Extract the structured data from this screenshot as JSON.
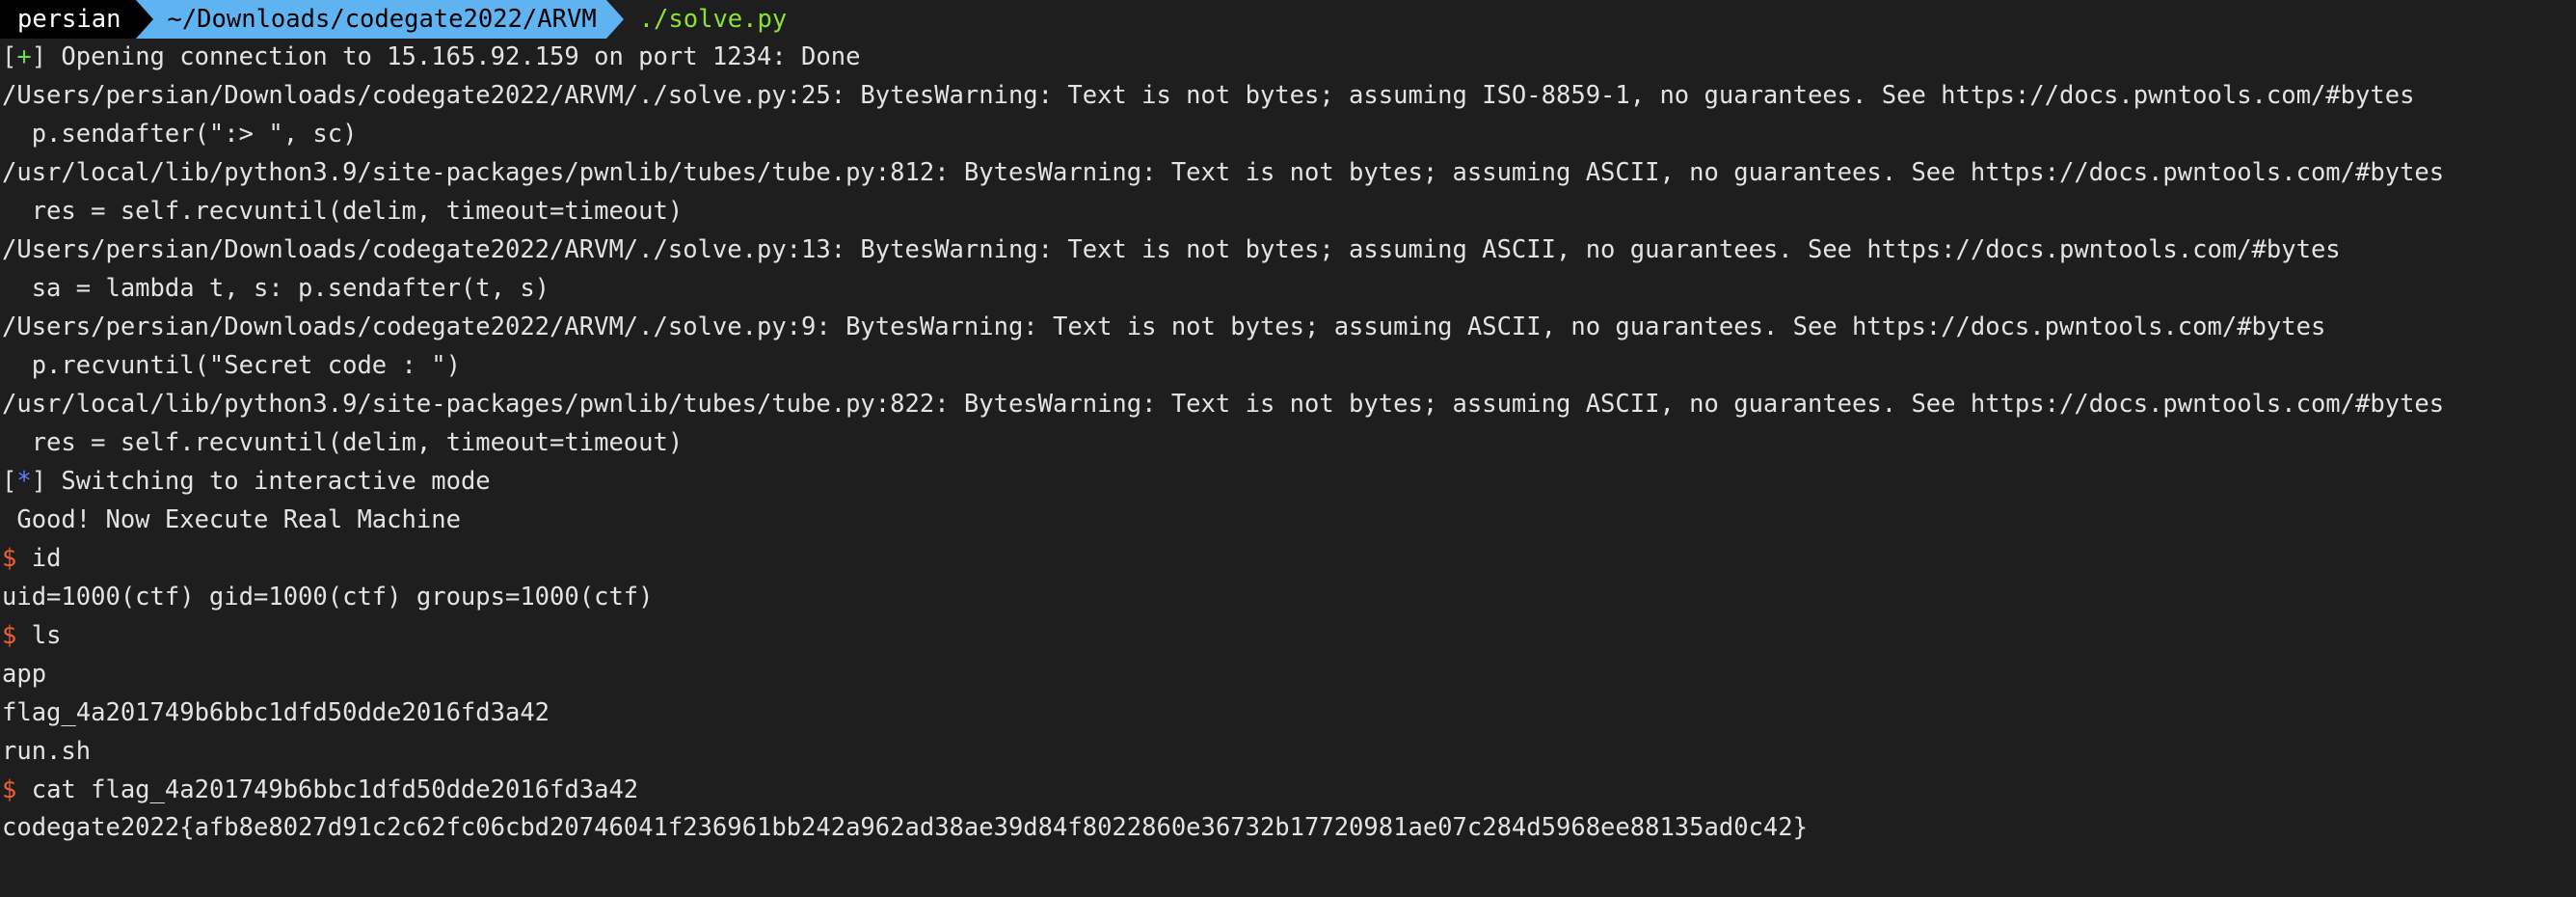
{
  "prompt": {
    "user": "persian",
    "path": "~/Downloads/codegate2022/ARVM",
    "command": "./solve.py"
  },
  "output": {
    "l1_open": "[",
    "l1_mark": "+",
    "l1_close": "]",
    "l1_text": " Opening connection to 15.165.92.159 on port 1234: Done",
    "l2": "/Users/persian/Downloads/codegate2022/ARVM/./solve.py:25: BytesWarning: Text is not bytes; assuming ISO-8859-1, no guarantees. See https://docs.pwntools.com/#bytes",
    "l3": "  p.sendafter(\":> \", sc)",
    "l4": "/usr/local/lib/python3.9/site-packages/pwnlib/tubes/tube.py:812: BytesWarning: Text is not bytes; assuming ASCII, no guarantees. See https://docs.pwntools.com/#bytes",
    "l5": "  res = self.recvuntil(delim, timeout=timeout)",
    "l6": "/Users/persian/Downloads/codegate2022/ARVM/./solve.py:13: BytesWarning: Text is not bytes; assuming ASCII, no guarantees. See https://docs.pwntools.com/#bytes",
    "l7": "  sa = lambda t, s: p.sendafter(t, s)",
    "l8": "/Users/persian/Downloads/codegate2022/ARVM/./solve.py:9: BytesWarning: Text is not bytes; assuming ASCII, no guarantees. See https://docs.pwntools.com/#bytes",
    "l9": "  p.recvuntil(\"Secret code : \")",
    "l10": "/usr/local/lib/python3.9/site-packages/pwnlib/tubes/tube.py:822: BytesWarning: Text is not bytes; assuming ASCII, no guarantees. See https://docs.pwntools.com/#bytes",
    "l11": "  res = self.recvuntil(delim, timeout=timeout)",
    "l12_open": "[",
    "l12_mark": "*",
    "l12_close": "]",
    "l12_text": " Switching to interactive mode",
    "l13": " Good! Now Execute Real Machine",
    "l14_dollar": "$",
    "l14_cmd": " id",
    "l15": "uid=1000(ctf) gid=1000(ctf) groups=1000(ctf)",
    "l16_dollar": "$",
    "l16_cmd": " ls",
    "l17": "app",
    "l18": "flag_4a201749b6bbc1dfd50dde2016fd3a42",
    "l19": "run.sh",
    "l20_dollar": "$",
    "l20_cmd": " cat flag_4a201749b6bbc1dfd50dde2016fd3a42",
    "l21": "codegate2022{afb8e8027d91c2c62fc06cbd20746041f236961bb242a962ad38ae39d84f8022860e36732b17720981ae07c284d5968ee88135ad0c42}"
  },
  "colors": {
    "background": "#1e1e1e",
    "path_segment": "#5fb3f0",
    "command": "#8ae234",
    "success_mark": "#6cd95a",
    "info_mark": "#6a7cff",
    "dollar": "#f0602c"
  }
}
